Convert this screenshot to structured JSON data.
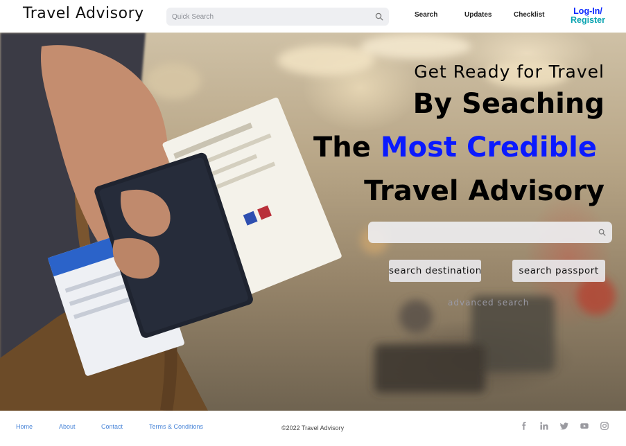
{
  "header": {
    "brand": "Travel Advisory",
    "search_placeholder": "Quick Search",
    "nav": {
      "search": "Search",
      "updates": "Updates",
      "checklist": "Checklist"
    },
    "login_line1": "Log-In/",
    "login_line2": "Register"
  },
  "hero": {
    "line1": "Get Ready for Travel",
    "line2": "By Seaching",
    "line3_prefix": "The ",
    "line3_accent": "Most Credible",
    "line4": "Travel Advisory",
    "search_placeholder": "",
    "btn_destination": "search destination",
    "btn_passport": "search passport",
    "advanced": "advanced search"
  },
  "footer": {
    "links": {
      "home": "Home",
      "about": "About",
      "contact": "Contact",
      "terms": "Terms & Conditions"
    },
    "copyright": "©2022 Travel Advisory"
  },
  "icons": {
    "quick_search": "search-icon",
    "hero_search": "search-icon",
    "social": [
      "facebook-icon",
      "linkedin-icon",
      "twitter-icon",
      "youtube-icon",
      "instagram-icon"
    ]
  },
  "colors": {
    "accent_blue": "#0a1aff",
    "login_blue": "#0a27ff",
    "register_teal": "#08a3b0",
    "footer_link": "#4a86d8",
    "advanced_link": "#9a9aa6"
  }
}
